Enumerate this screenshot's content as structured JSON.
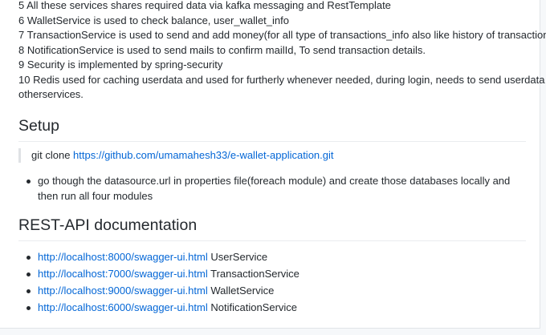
{
  "overview_lines": [
    "5 All these services shares required data via kafka messaging and RestTemplate",
    "6 WalletService is used to check balance, user_wallet_info",
    "7 TransactionService is used to send and add money(for all type of transactions_info also like history of transactions)",
    "8 NotificationService is used to send mails to confirm mailId, To send transaction details.",
    "9 Security is implemented by spring-security",
    "10 Redis used for caching userdata and used for furtherly whenever needed, during login, needs to send userdata to",
    "otherservices."
  ],
  "setup": {
    "heading": "Setup",
    "clone_prefix": "git clone",
    "clone_link": "https://github.com/umamahesh33/e-wallet-application.git",
    "bullet_text": "go though the datasource.url in properties file(foreach module) and create those databases locally and then run all four modules"
  },
  "rest_api": {
    "heading": "REST-API documentation",
    "items": [
      {
        "url": "http://localhost:8000/swagger-ui.html",
        "service": "UserService"
      },
      {
        "url": "http://localhost:7000/swagger-ui.html",
        "service": "TransactionService"
      },
      {
        "url": "http://localhost:9000/swagger-ui.html",
        "service": "WalletService"
      },
      {
        "url": "http://localhost:6000/swagger-ui.html",
        "service": "NotificationService"
      }
    ]
  },
  "colors": {
    "link": "#0366d6",
    "text": "#24292e",
    "rule": "#eaecef"
  }
}
